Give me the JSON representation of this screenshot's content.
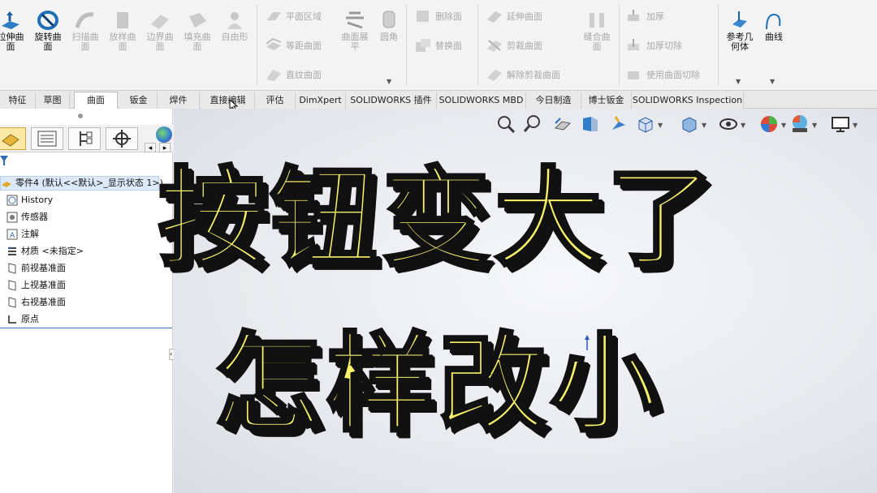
{
  "ribbon": {
    "big_buttons": [
      {
        "id": "extrude-surface",
        "label": "拉伸曲\n面",
        "state": "active"
      },
      {
        "id": "revolve-surface",
        "label": "旋转曲\n面",
        "state": "active"
      },
      {
        "id": "sweep-surface",
        "label": "扫描曲\n面",
        "state": "dim"
      },
      {
        "id": "loft-surface",
        "label": "放样曲\n面",
        "state": "dim"
      },
      {
        "id": "boundary-surface",
        "label": "边界曲\n面",
        "state": "dim"
      },
      {
        "id": "fill-surface",
        "label": "填充曲\n面",
        "state": "dim"
      },
      {
        "id": "freeform",
        "label": "自由形",
        "state": "dim"
      }
    ],
    "group2": [
      "平面区域",
      "等距曲面",
      "直纹曲面"
    ],
    "group2_big": [
      {
        "label": "曲面展\n平"
      },
      {
        "label": "圆角"
      }
    ],
    "group3": [
      "删除面",
      "替换面"
    ],
    "group4": [
      "延伸曲面",
      "剪裁曲面",
      "解除剪裁曲面"
    ],
    "group4_big": [
      {
        "label": "缝合曲\n面"
      }
    ],
    "group5": [
      "加厚",
      "加厚切除",
      "使用曲面切除"
    ],
    "group6_big": [
      {
        "label": "参考几\n何体"
      },
      {
        "label": "曲线"
      }
    ]
  },
  "tabs": [
    "特征",
    "草图",
    "曲面",
    "钣金",
    "焊件",
    "直接编辑",
    "评估",
    "DimXpert",
    "SOLIDWORKS 插件",
    "SOLIDWORKS MBD",
    "今日制造",
    "博士钣金",
    "SOLIDWORKS Inspection"
  ],
  "active_tab": "曲面",
  "tree": {
    "root": "零件4  (默认<<默认>_显示状态 1>)",
    "items": [
      "History",
      "传感器",
      "注解",
      "材质 <未指定>",
      "前视基准面",
      "上视基准面",
      "右视基准面",
      "原点"
    ]
  },
  "overlay": {
    "line1": "按钮变大了",
    "line2": "怎样改小"
  },
  "colors": {
    "title_fill": "#f8f36b",
    "title_outline": "#111111",
    "active_panel_tab": "#fde9a6"
  }
}
